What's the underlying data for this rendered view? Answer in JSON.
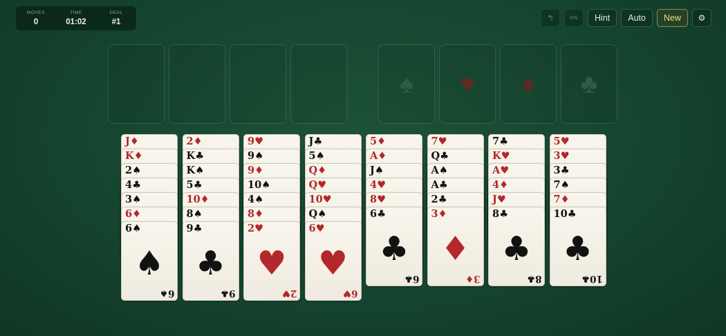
{
  "hud": {
    "moves_label": "MOVES",
    "moves_value": "0",
    "time_label": "TIME",
    "time_value": "01:02",
    "deal_label": "DEAL",
    "deal_value": "#1"
  },
  "toolbar": {
    "undo_glyph": "↰",
    "rw_label": "RW",
    "hint_label": "Hint",
    "auto_label": "Auto",
    "new_label": "New",
    "settings_glyph": "⚙"
  },
  "free_cells": [
    {
      "card": null
    },
    {
      "card": null
    },
    {
      "card": null
    },
    {
      "card": null
    }
  ],
  "foundations": [
    {
      "suit": "♠",
      "color": "black",
      "icon": "spade-icon"
    },
    {
      "suit": "♥",
      "color": "red",
      "icon": "heart-icon"
    },
    {
      "suit": "♦",
      "color": "red",
      "icon": "diamond-icon"
    },
    {
      "suit": "♣",
      "color": "black",
      "icon": "club-icon"
    }
  ],
  "colors": {
    "felt": "#154530",
    "card_face": "#f8f5ec",
    "red_suit": "#b3282a",
    "black_suit": "#121212",
    "new_button_accent": "#f0dc8a"
  },
  "tableau": [
    [
      {
        "rank": "J",
        "suit": "♦",
        "color": "red"
      },
      {
        "rank": "K",
        "suit": "♦",
        "color": "red"
      },
      {
        "rank": "2",
        "suit": "♠",
        "color": "black"
      },
      {
        "rank": "4",
        "suit": "♣",
        "color": "black"
      },
      {
        "rank": "3",
        "suit": "♠",
        "color": "black"
      },
      {
        "rank": "6",
        "suit": "♦",
        "color": "red"
      },
      {
        "rank": "6",
        "suit": "♠",
        "color": "black"
      }
    ],
    [
      {
        "rank": "2",
        "suit": "♦",
        "color": "red"
      },
      {
        "rank": "K",
        "suit": "♣",
        "color": "black"
      },
      {
        "rank": "K",
        "suit": "♠",
        "color": "black"
      },
      {
        "rank": "5",
        "suit": "♣",
        "color": "black"
      },
      {
        "rank": "10",
        "suit": "♦",
        "color": "red"
      },
      {
        "rank": "8",
        "suit": "♠",
        "color": "black"
      },
      {
        "rank": "9",
        "suit": "♣",
        "color": "black"
      }
    ],
    [
      {
        "rank": "9",
        "suit": "♥",
        "color": "red"
      },
      {
        "rank": "9",
        "suit": "♠",
        "color": "black"
      },
      {
        "rank": "9",
        "suit": "♦",
        "color": "red"
      },
      {
        "rank": "10",
        "suit": "♠",
        "color": "black"
      },
      {
        "rank": "4",
        "suit": "♠",
        "color": "black"
      },
      {
        "rank": "8",
        "suit": "♦",
        "color": "red"
      },
      {
        "rank": "2",
        "suit": "♥",
        "color": "red"
      }
    ],
    [
      {
        "rank": "J",
        "suit": "♣",
        "color": "black"
      },
      {
        "rank": "5",
        "suit": "♠",
        "color": "black"
      },
      {
        "rank": "Q",
        "suit": "♦",
        "color": "red"
      },
      {
        "rank": "Q",
        "suit": "♥",
        "color": "red"
      },
      {
        "rank": "10",
        "suit": "♥",
        "color": "red"
      },
      {
        "rank": "Q",
        "suit": "♠",
        "color": "black"
      },
      {
        "rank": "6",
        "suit": "♥",
        "color": "red"
      }
    ],
    [
      {
        "rank": "5",
        "suit": "♦",
        "color": "red"
      },
      {
        "rank": "A",
        "suit": "♦",
        "color": "red"
      },
      {
        "rank": "J",
        "suit": "♠",
        "color": "black"
      },
      {
        "rank": "4",
        "suit": "♥",
        "color": "red"
      },
      {
        "rank": "8",
        "suit": "♥",
        "color": "red"
      },
      {
        "rank": "6",
        "suit": "♣",
        "color": "black"
      }
    ],
    [
      {
        "rank": "7",
        "suit": "♥",
        "color": "red"
      },
      {
        "rank": "Q",
        "suit": "♣",
        "color": "black"
      },
      {
        "rank": "A",
        "suit": "♠",
        "color": "black"
      },
      {
        "rank": "A",
        "suit": "♣",
        "color": "black"
      },
      {
        "rank": "2",
        "suit": "♣",
        "color": "black"
      },
      {
        "rank": "3",
        "suit": "♦",
        "color": "red"
      }
    ],
    [
      {
        "rank": "7",
        "suit": "♣",
        "color": "black"
      },
      {
        "rank": "K",
        "suit": "♥",
        "color": "red"
      },
      {
        "rank": "A",
        "suit": "♥",
        "color": "red"
      },
      {
        "rank": "4",
        "suit": "♦",
        "color": "red"
      },
      {
        "rank": "J",
        "suit": "♥",
        "color": "red"
      },
      {
        "rank": "8",
        "suit": "♣",
        "color": "black"
      }
    ],
    [
      {
        "rank": "5",
        "suit": "♥",
        "color": "red"
      },
      {
        "rank": "3",
        "suit": "♥",
        "color": "red"
      },
      {
        "rank": "3",
        "suit": "♣",
        "color": "black"
      },
      {
        "rank": "7",
        "suit": "♠",
        "color": "black"
      },
      {
        "rank": "7",
        "suit": "♦",
        "color": "red"
      },
      {
        "rank": "10",
        "suit": "♣",
        "color": "black"
      }
    ]
  ]
}
